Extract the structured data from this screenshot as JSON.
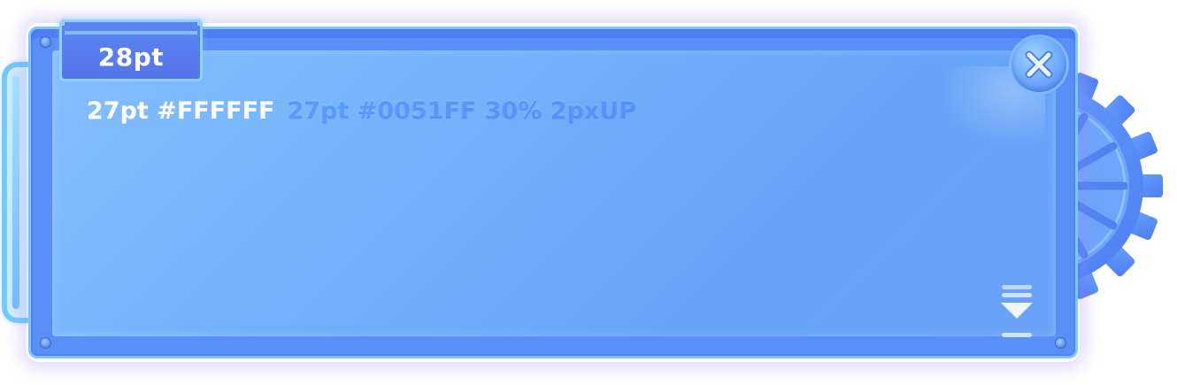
{
  "dialog": {
    "title": "28pt",
    "line_primary": "27pt #FFFFFF",
    "line_secondary": "27pt #0051FF 30% 2pxUP"
  },
  "colors": {
    "panel_border": "#7EC6FF",
    "panel_fill": "#6AA8FA",
    "title_tab_fill": "#5A80F0",
    "text_primary": "#FFFFFF",
    "text_secondary": "#0051FF",
    "gear": "#4F86F4"
  },
  "icons": {
    "close": "close-x-icon",
    "gear": "gear-icon",
    "scroll_down": "chevron-down-icon"
  }
}
